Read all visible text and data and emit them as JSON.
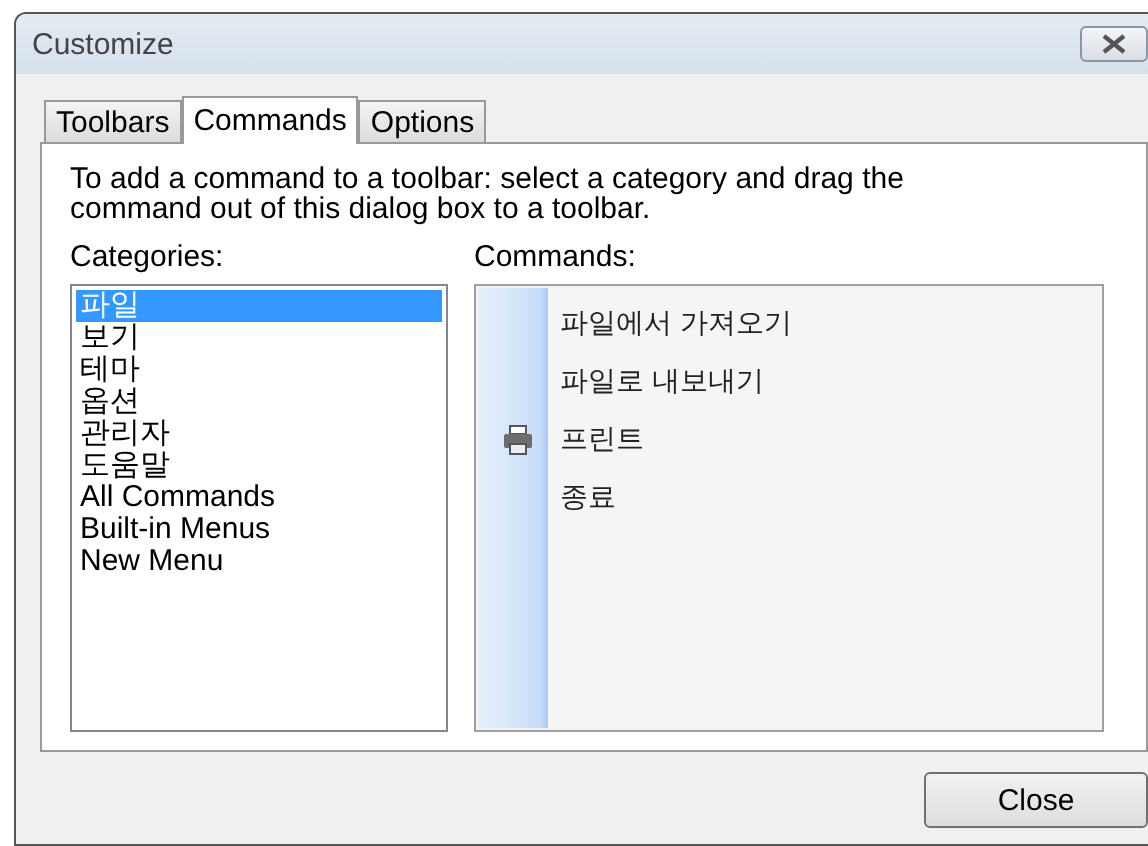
{
  "window": {
    "title": "Customize"
  },
  "tabs": [
    {
      "label": "Toolbars",
      "selected": false
    },
    {
      "label": "Commands",
      "selected": true
    },
    {
      "label": "Options",
      "selected": false
    }
  ],
  "instructions": "To add a command to a toolbar: select a category and drag the command out of this dialog box to a toolbar.",
  "categories": {
    "label": "Categories:",
    "items": [
      {
        "label": "파일",
        "selected": true
      },
      {
        "label": "보기",
        "selected": false
      },
      {
        "label": "테마",
        "selected": false
      },
      {
        "label": "옵션",
        "selected": false
      },
      {
        "label": "관리자",
        "selected": false
      },
      {
        "label": "도움말",
        "selected": false
      },
      {
        "label": "All Commands",
        "selected": false
      },
      {
        "label": "Built-in Menus",
        "selected": false
      },
      {
        "label": "New Menu",
        "selected": false
      }
    ]
  },
  "commands": {
    "label": "Commands:",
    "items": [
      {
        "label": "파일에서 가져오기",
        "kind": "plain"
      },
      {
        "label": "파일로 내보내기",
        "kind": "plain"
      },
      {
        "label": "프린트",
        "kind": "printer"
      },
      {
        "label": "종료",
        "kind": "plain"
      }
    ]
  },
  "buttons": [
    {
      "label": "Close"
    }
  ]
}
